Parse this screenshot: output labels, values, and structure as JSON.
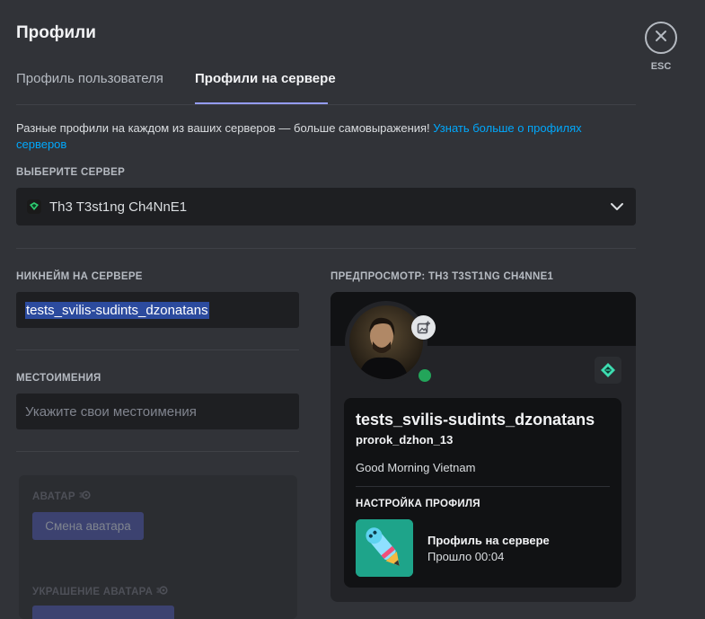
{
  "page": {
    "title": "Профили"
  },
  "tabs": [
    {
      "label": "Профиль пользователя",
      "active": false
    },
    {
      "label": "Профили на сервере",
      "active": true
    }
  ],
  "description": {
    "text": "Разные профили на каждом из ваших серверов — больше самовыражения! ",
    "link": "Узнать больше о профилях серверов"
  },
  "server_select": {
    "label": "ВЫБЕРИТЕ СЕРВЕР",
    "value": "Th3 T3st1ng Ch4NnE1",
    "icon": "server-icon"
  },
  "nickname": {
    "label": "НИКНЕЙМ НА СЕРВЕРЕ",
    "value": "tests_svilis-sudints_dzonatans"
  },
  "pronouns": {
    "label": "МЕСТОИМЕНИЯ",
    "placeholder": "Укажите свои местоимения"
  },
  "avatar_section": {
    "label": "АВАТАР",
    "button": "Смена аватара",
    "decoration_label": "УКРАШЕНИЕ АВАТАРА"
  },
  "preview": {
    "label": "ПРЕДПРОСМОТР: TH3 T3ST1NG CH4NNE1",
    "display_name": "tests_svilis-sudints_dzonatans",
    "username": "prorok_dzhon_13",
    "bio": "Good Morning Vietnam",
    "section_label": "НАСТРОЙКА ПРОФИЛЯ",
    "activity_title": "Профиль на сервере",
    "activity_time": "Прошло 00:04",
    "status": "online"
  },
  "close": {
    "label": "ESC",
    "icon": "close-icon"
  },
  "colors": {
    "background": "#313338",
    "accent": "#949cf7",
    "link": "#00a8fc",
    "online": "#23a55a",
    "selection": "#2c4b9e"
  }
}
